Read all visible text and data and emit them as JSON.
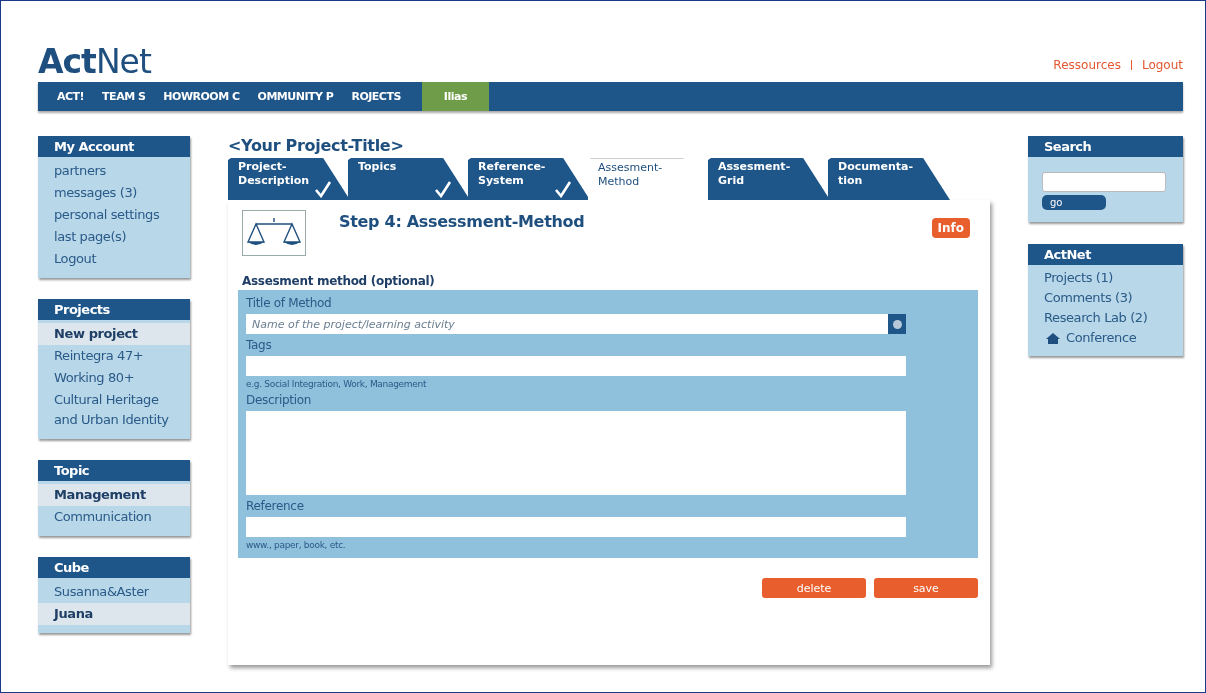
{
  "logo": {
    "bold": "Act",
    "light": "Net"
  },
  "top_links": [
    "Ressources",
    "Logout"
  ],
  "nav": [
    {
      "label": "ACT!",
      "selected": false
    },
    {
      "label": "TEAM S",
      "selected": false
    },
    {
      "label": "HOWROOM C",
      "selected": false
    },
    {
      "label": "OMMUNITY P",
      "selected": false
    },
    {
      "label": "ROJECTS",
      "selected": false
    },
    {
      "label": "Ilias",
      "selected": true
    }
  ],
  "left_boxes": [
    {
      "title": "My Account",
      "items": [
        {
          "label": "partners",
          "selected": false
        },
        {
          "label": "messages (3)",
          "selected": false
        },
        {
          "label": "personal settings",
          "selected": false
        },
        {
          "label": "last page(s)",
          "selected": false
        },
        {
          "label": "Logout",
          "selected": false
        }
      ]
    },
    {
      "title": "Projects",
      "items": [
        {
          "label": "New project",
          "selected": true
        },
        {
          "label": "Reintegra 47+",
          "selected": false
        },
        {
          "label": "Working 80+",
          "selected": false
        },
        {
          "label": "Cultural Heritage and Urban Identity",
          "selected": false
        }
      ]
    },
    {
      "title": "Topic",
      "items": [
        {
          "label": "Management",
          "selected": true
        },
        {
          "label": "Communication",
          "selected": false
        }
      ]
    },
    {
      "title": "Cube",
      "items": [
        {
          "label": "Susanna&Aster",
          "selected": false
        },
        {
          "label": "Juana",
          "selected": true
        }
      ]
    }
  ],
  "project_title": "<Your Project-Title>",
  "tabs": [
    {
      "lines": [
        "Project-",
        "Description"
      ],
      "done": true,
      "selected": false
    },
    {
      "lines": [
        "Topics"
      ],
      "done": true,
      "selected": false
    },
    {
      "lines": [
        "Reference-",
        "System"
      ],
      "done": true,
      "selected": false
    },
    {
      "lines": [
        "Assesment-",
        "Method"
      ],
      "done": false,
      "selected": true
    },
    {
      "lines": [
        "Assesment-",
        "Grid"
      ],
      "done": false,
      "selected": false
    },
    {
      "lines": [
        "Documenta-",
        "tion"
      ],
      "done": false,
      "selected": false
    }
  ],
  "step_title": "Step 4:  Assessment-Method",
  "info_button": "Info",
  "section_title": "Assesment method (optional)",
  "fields": [
    {
      "label": "Title of Method",
      "kind": "input",
      "placeholder": "Name of the project/learning activity"
    },
    {
      "label": "Tags",
      "kind": "input",
      "hint": "e.g. Social Integration, Work, Management"
    },
    {
      "label": "Description",
      "kind": "textarea"
    },
    {
      "label": "Reference",
      "kind": "input",
      "hint": "www., paper,  book, etc."
    }
  ],
  "buttons": [
    "delete",
    "save"
  ],
  "search": {
    "title": "Search",
    "button": "go"
  },
  "right_box": {
    "title": "ActNet",
    "items": [
      {
        "label": "Projects (1)",
        "kind": "link"
      },
      {
        "label": "Comments (3)",
        "kind": "link"
      },
      {
        "label": "Research Lab (2)",
        "kind": "link"
      },
      {
        "label": "Conference",
        "kind": "home"
      }
    ]
  }
}
